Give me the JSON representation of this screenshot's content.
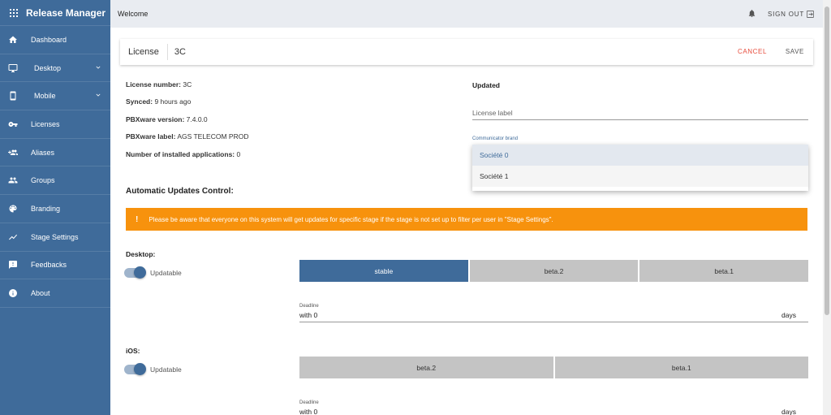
{
  "app": {
    "title": "Release Manager"
  },
  "sidebar": {
    "items": [
      {
        "label": "Dashboard"
      },
      {
        "label": "Desktop"
      },
      {
        "label": "Mobile"
      },
      {
        "label": "Licenses"
      },
      {
        "label": "Aliases"
      },
      {
        "label": "Groups"
      },
      {
        "label": "Branding"
      },
      {
        "label": "Stage Settings"
      },
      {
        "label": "Feedbacks"
      },
      {
        "label": "About"
      }
    ]
  },
  "topbar": {
    "welcome": "Welcome",
    "signout": "SIGN OUT"
  },
  "header": {
    "label": "License",
    "value": "3C",
    "cancel": "CANCEL",
    "save": "SAVE"
  },
  "info": {
    "license_number_label": "License number:",
    "license_number": " 3C",
    "synced_label": "Synced:",
    "synced": " 9 hours ago",
    "pbx_version_label": "PBXware version:",
    "pbx_version": " 7.4.0.0",
    "pbx_label_label": "PBXware label:",
    "pbx_label": " AGS TELECOM PROD",
    "apps_label": "Number of installed applications:",
    "apps": " 0"
  },
  "right": {
    "updated": "Updated",
    "license_label_placeholder": "License label",
    "brand_label": "Communicator brand",
    "brand_options": [
      "Société 0",
      "Société 1"
    ]
  },
  "updates": {
    "title": "Automatic Updates Control:",
    "warning": "Please be aware that everyone on this system will get updates for specific stage if the stage is not set up to filter per user in \"Stage Settings\".",
    "desktop": {
      "label": "Desktop:",
      "toggle_label": "Updatable",
      "stages": [
        "stable",
        "beta.2",
        "beta.1"
      ],
      "deadline_label": "Deadline",
      "deadline_value": "with 0",
      "deadline_unit": "days"
    },
    "ios": {
      "label": "iOS:",
      "toggle_label": "Updatable",
      "stages": [
        "beta.2",
        "beta.1"
      ],
      "deadline_label": "Deadline",
      "deadline_value": "with 0",
      "deadline_unit": "days"
    }
  },
  "colors": {
    "sidebar": "#3f6b9a",
    "warning": "#f7920d",
    "active_stage": "#3f6b9a",
    "cancel": "#e74c3c"
  }
}
